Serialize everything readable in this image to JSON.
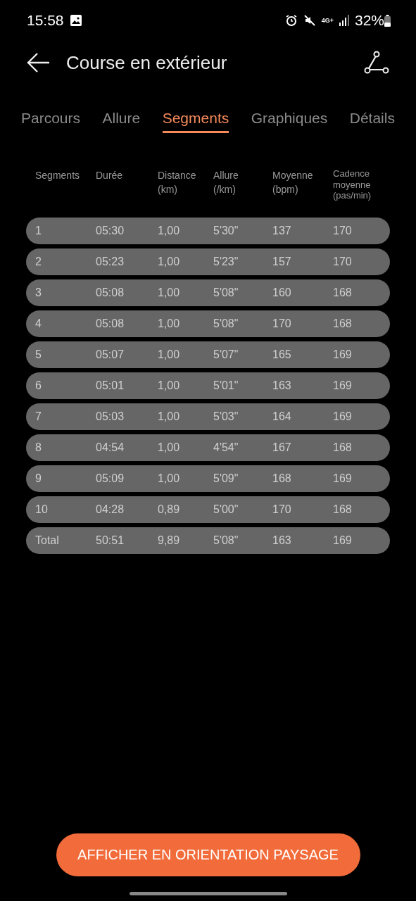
{
  "status_bar": {
    "time": "15:58",
    "network": "4G+",
    "battery": "32%"
  },
  "app_bar": {
    "title": "Course en extérieur"
  },
  "tabs": [
    {
      "label": "Parcours",
      "selected": false
    },
    {
      "label": "Allure",
      "selected": false
    },
    {
      "label": "Segments",
      "selected": true
    },
    {
      "label": "Graphiques",
      "selected": false
    },
    {
      "label": "Détails",
      "selected": false
    }
  ],
  "table": {
    "columns": [
      "Segments",
      "Durée",
      "Distance\n (km)",
      "Allure\n (/km)",
      "Moyenne\n (bpm)",
      "Cadence\nmoyenne\n (pas/min)"
    ],
    "rows": [
      [
        "1",
        "05:30",
        "1,00",
        "5'30\"",
        "137",
        "170"
      ],
      [
        "2",
        "05:23",
        "1,00",
        "5'23\"",
        "157",
        "170"
      ],
      [
        "3",
        "05:08",
        "1,00",
        "5'08\"",
        "160",
        "168"
      ],
      [
        "4",
        "05:08",
        "1,00",
        "5'08\"",
        "170",
        "168"
      ],
      [
        "5",
        "05:07",
        "1,00",
        "5'07\"",
        "165",
        "169"
      ],
      [
        "6",
        "05:01",
        "1,00",
        "5'01\"",
        "163",
        "169"
      ],
      [
        "7",
        "05:03",
        "1,00",
        "5'03\"",
        "164",
        "169"
      ],
      [
        "8",
        "04:54",
        "1,00",
        "4'54\"",
        "167",
        "168"
      ],
      [
        "9",
        "05:09",
        "1,00",
        "5'09\"",
        "168",
        "169"
      ],
      [
        "10",
        "04:28",
        "0,89",
        "5'00\"",
        "170",
        "168"
      ],
      [
        "Total",
        "50:51",
        "9,89",
        "5'08\"",
        "163",
        "169"
      ]
    ]
  },
  "landscape_button": {
    "label": "AFFICHER EN ORIENTATION PAYSAGE"
  }
}
